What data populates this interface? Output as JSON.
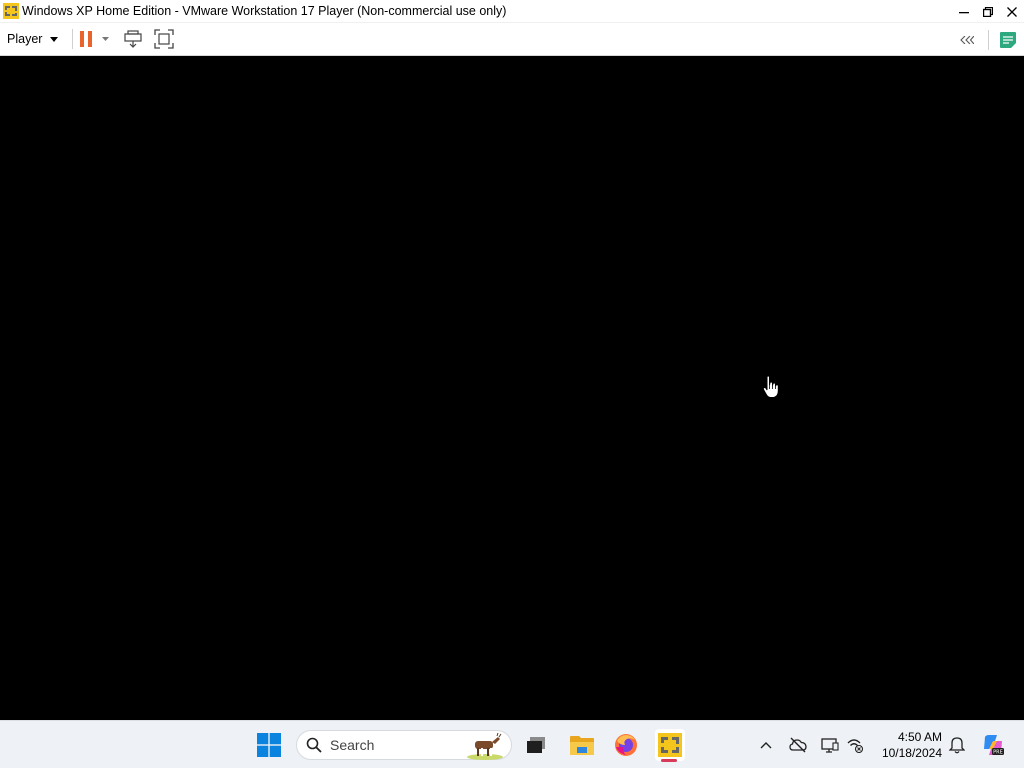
{
  "window": {
    "title": "Windows XP Home Edition - VMware Workstation 17 Player (Non-commercial use only)",
    "controls": [
      "minimize",
      "maximize",
      "close"
    ]
  },
  "toolbar": {
    "player_menu_label": "Player",
    "icons": [
      "pause-icon",
      "dropdown-caret-icon",
      "send-ctrl-alt-del-icon",
      "fullscreen-icon",
      "collapse-icon",
      "notes-icon"
    ],
    "pause_color": "#e8642c"
  },
  "vm": {
    "screen_color": "#000000"
  },
  "taskbar": {
    "search_placeholder": "Search",
    "pinned": [
      "start-icon",
      "search-icon",
      "task-view-icon",
      "file-explorer-icon",
      "firefox-icon",
      "vmware-player-icon"
    ],
    "tray_icons": [
      "chevron-up-icon",
      "cloud-offline-icon",
      "display-icon",
      "network-icon",
      "bell-icon",
      "copilot-icon"
    ],
    "clock": {
      "time": "4:50 AM",
      "date": "10/18/2024"
    }
  }
}
